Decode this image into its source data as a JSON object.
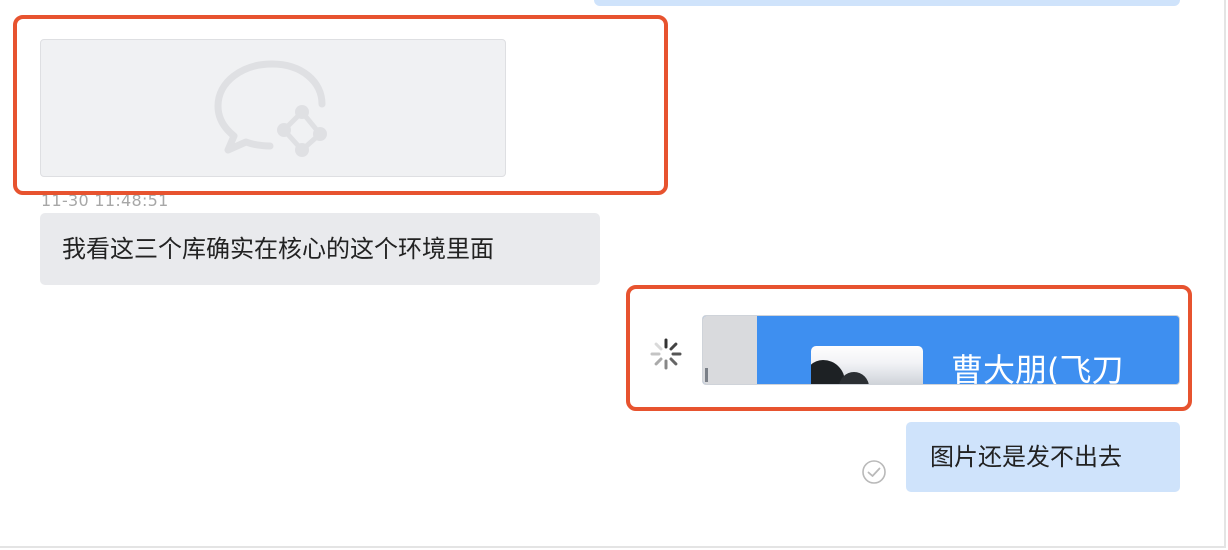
{
  "chat": {
    "messages": [
      {
        "type": "image",
        "direction": "incoming",
        "state": "failed-placeholder",
        "icon": "wecom-logo-icon"
      },
      {
        "type": "timestamp",
        "text": "11-30 11:48:51"
      },
      {
        "type": "text",
        "direction": "incoming",
        "text": "我看这三个库确实在核心的这个环境里面"
      },
      {
        "type": "image",
        "direction": "outgoing",
        "state": "sending",
        "caption_visible": "曹大朋(飞刀"
      },
      {
        "type": "text",
        "direction": "outgoing",
        "text": "图片还是发不出去",
        "status_icon": "check-circle-icon"
      }
    ]
  },
  "colors": {
    "incoming_bubble": "#e9eaed",
    "outgoing_bubble": "#cfe3fb",
    "annotation": "#e7532f",
    "image_blue": "#3e8ff0"
  }
}
